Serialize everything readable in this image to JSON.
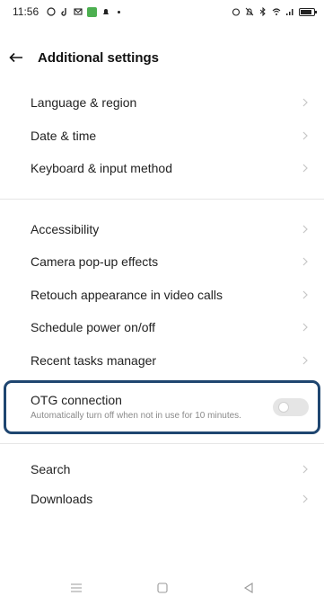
{
  "status_bar": {
    "time": "11:56",
    "icons_left": [
      "whatsapp-icon",
      "music-icon",
      "mail-icon",
      "app-green-icon",
      "notification-icon",
      "dot-icon"
    ],
    "icons_right": [
      "alarm-icon",
      "mute-icon",
      "bluetooth-icon",
      "wifi-icon",
      "signal-icon",
      "battery-icon"
    ],
    "battery_level": 0.85
  },
  "header": {
    "back_icon": "arrow-left-icon",
    "title": "Additional settings"
  },
  "groups": [
    {
      "items": [
        {
          "label": "Language & region"
        },
        {
          "label": "Date & time"
        },
        {
          "label": "Keyboard & input method"
        }
      ]
    },
    {
      "items": [
        {
          "label": "Accessibility"
        },
        {
          "label": "Camera pop-up effects"
        },
        {
          "label": "Retouch appearance in video calls"
        },
        {
          "label": "Schedule power on/off"
        },
        {
          "label": "Recent tasks manager"
        }
      ]
    }
  ],
  "otg": {
    "title": "OTG connection",
    "subtitle": "Automatically turn off when not in use for 10 minutes.",
    "enabled": false,
    "highlight_color": "#1f4670"
  },
  "bottom_items": [
    {
      "label": "Search"
    },
    {
      "label": "Downloads"
    }
  ],
  "nav": [
    "menu-icon",
    "home-icon",
    "back-triangle-icon"
  ]
}
